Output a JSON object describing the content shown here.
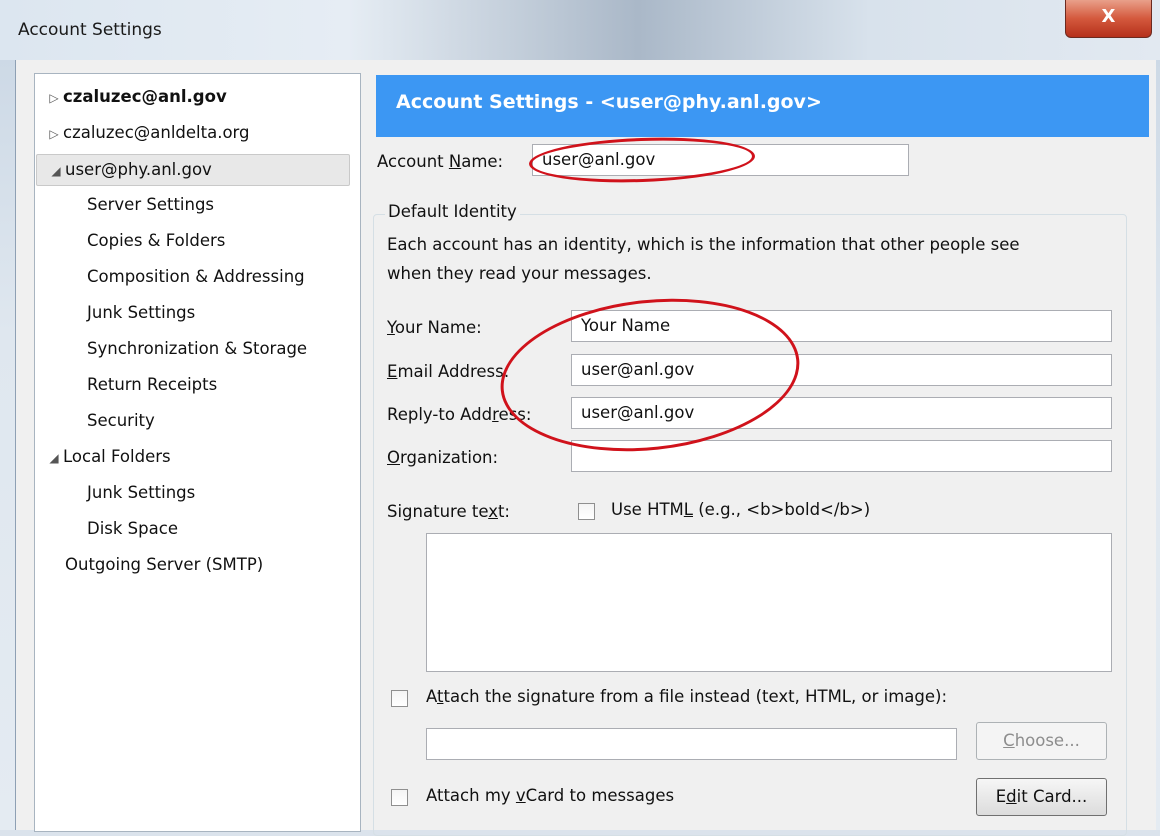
{
  "window": {
    "title": "Account Settings",
    "close_glyph": "X"
  },
  "tree": [
    {
      "label": "czaluzec@anl.gov",
      "level": 0,
      "twisty": "▷",
      "bold": true
    },
    {
      "label": "czaluzec@anldelta.org",
      "level": 0,
      "twisty": "▷"
    },
    {
      "label": "user@phy.anl.gov",
      "level": 0,
      "twisty": "◢",
      "selected": true
    },
    {
      "label": "Server Settings",
      "level": 1
    },
    {
      "label": "Copies & Folders",
      "level": 1
    },
    {
      "label": "Composition & Addressing",
      "level": 1
    },
    {
      "label": "Junk Settings",
      "level": 1
    },
    {
      "label": "Synchronization & Storage",
      "level": 1
    },
    {
      "label": "Return Receipts",
      "level": 1
    },
    {
      "label": "Security",
      "level": 1
    },
    {
      "label": "Local Folders",
      "level": 0,
      "twisty": "◢"
    },
    {
      "label": "Junk Settings",
      "level": 1
    },
    {
      "label": "Disk Space",
      "level": 1
    },
    {
      "label": "Outgoing Server (SMTP)",
      "level": 0,
      "twisty": ""
    }
  ],
  "panel": {
    "banner": "Account Settings - <user@phy.anl.gov>",
    "account_name": {
      "label_pre": "Account ",
      "label_u": "N",
      "label_post": "ame:",
      "value": "user@anl.gov"
    },
    "identity_group": "Default Identity",
    "identity_desc_1": "Each account has an identity, which is the information that other people see",
    "identity_desc_2": "when they read your messages.",
    "your_name": {
      "label_pre": "",
      "label_u": "Y",
      "label_post": "our Name:",
      "value": "Your Name"
    },
    "email": {
      "label_pre": "",
      "label_u": "E",
      "label_post": "mail Address:",
      "value": "user@anl.gov"
    },
    "reply_to": {
      "label_pre": "Reply-to Add",
      "label_u": "r",
      "label_post": "ess:",
      "value": "user@anl.gov"
    },
    "organization": {
      "label_pre": "",
      "label_u": "O",
      "label_post": "rganization:",
      "value": ""
    },
    "signature": {
      "label_pre": "Signature te",
      "label_u": "x",
      "label_post": "t:"
    },
    "use_html": {
      "label_pre": "Use HTM",
      "label_u": "L",
      "label_post": " (e.g., <b>bold</b>)",
      "checked": false
    },
    "attach_sig": {
      "label_pre": "A",
      "label_u": "t",
      "label_post": "tach the signature from a file instead (text, HTML, or image):",
      "checked": false
    },
    "choose": {
      "label_pre": "",
      "label_u": "C",
      "label_post": "hoose..."
    },
    "attach_vcard": {
      "label_pre": "Attach my ",
      "label_u": "v",
      "label_post": "Card to messages",
      "checked": false
    },
    "edit_card": {
      "label_pre": "E",
      "label_u": "d",
      "label_post": "it Card..."
    }
  },
  "colors": {
    "banner": "#3c97f3",
    "annotation": "#d0121b",
    "close": "#c8442a"
  }
}
